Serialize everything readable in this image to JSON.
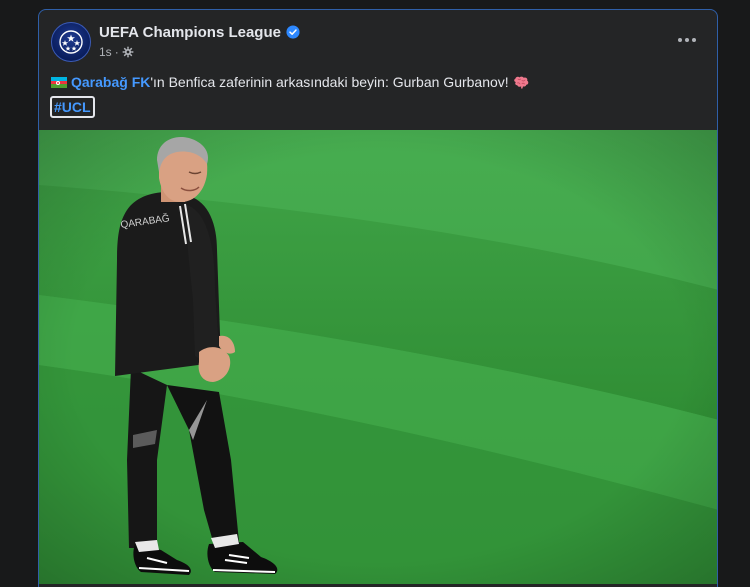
{
  "post": {
    "page_name": "UEFA Champions League",
    "timestamp": "1s",
    "separator": "·",
    "text_mention": "Qarabağ FK",
    "text_rest": "'ın Benfica zaferinin arkasındaki beyin: Gurban Gurbanov!",
    "hashtag": "#UCL"
  },
  "icons": {
    "avatar": "ucl-starball-icon",
    "verified": "verified-badge-icon",
    "audience": "gear-icon",
    "more": "more-options-icon",
    "flag": "azerbaijan-flag-icon",
    "emoji": "brain-emoji-icon"
  },
  "colors": {
    "background": "#18191a",
    "card": "#242526",
    "text": "#e4e6eb",
    "secondary_text": "#b0b3b8",
    "link": "#4599ff",
    "verified": "#2d88ff",
    "card_border": "#2f5fa8"
  }
}
